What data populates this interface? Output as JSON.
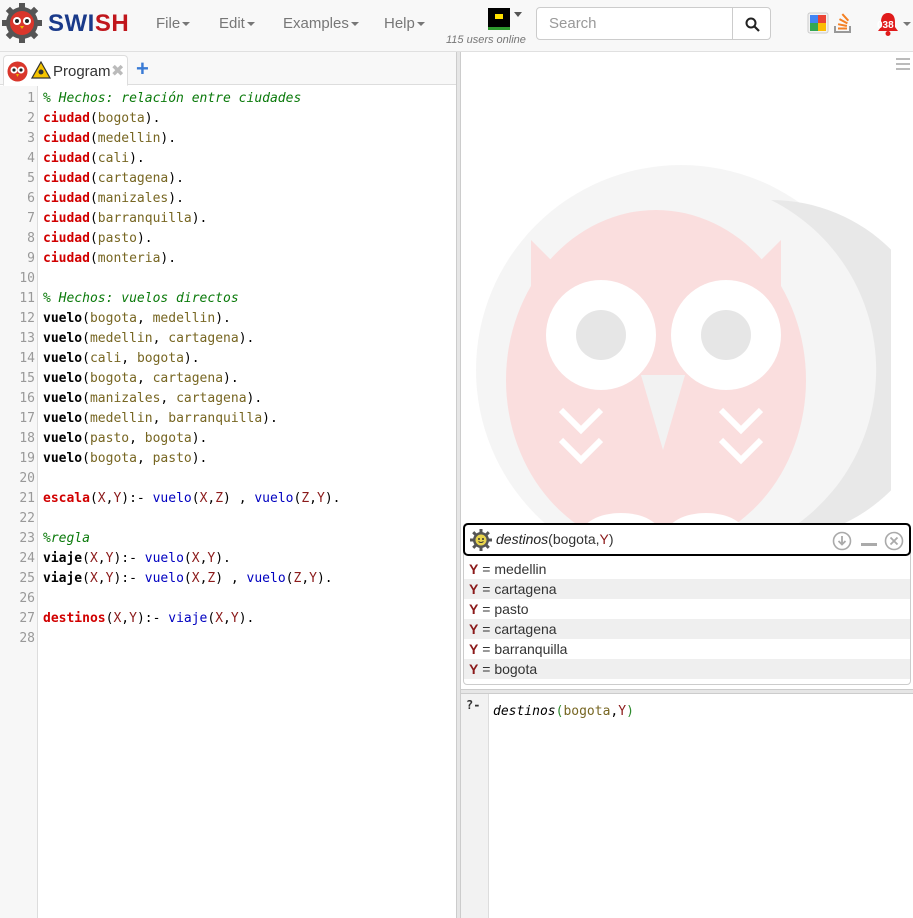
{
  "navbar": {
    "brand_sw": "SWI",
    "brand_sh": "SH",
    "menus": [
      "File",
      "Edit",
      "Examples",
      "Help"
    ],
    "users_online": "115 users online",
    "search_placeholder": "Search",
    "notification_count": "038"
  },
  "editor": {
    "tab_label": "Program",
    "lines": [
      [
        [
          "com",
          "% Hechos: relación entre ciudades"
        ]
      ],
      [
        [
          "red",
          "ciudad"
        ],
        [
          "p",
          "("
        ],
        [
          "atom",
          "bogota"
        ],
        [
          "p",
          ")."
        ]
      ],
      [
        [
          "red",
          "ciudad"
        ],
        [
          "p",
          "("
        ],
        [
          "atom",
          "medellin"
        ],
        [
          "p",
          ")."
        ]
      ],
      [
        [
          "red",
          "ciudad"
        ],
        [
          "p",
          "("
        ],
        [
          "atom",
          "cali"
        ],
        [
          "p",
          ")."
        ]
      ],
      [
        [
          "red",
          "ciudad"
        ],
        [
          "p",
          "("
        ],
        [
          "atom",
          "cartagena"
        ],
        [
          "p",
          ")."
        ]
      ],
      [
        [
          "red",
          "ciudad"
        ],
        [
          "p",
          "("
        ],
        [
          "atom",
          "manizales"
        ],
        [
          "p",
          ")."
        ]
      ],
      [
        [
          "red",
          "ciudad"
        ],
        [
          "p",
          "("
        ],
        [
          "atom",
          "barranquilla"
        ],
        [
          "p",
          ")."
        ]
      ],
      [
        [
          "red",
          "ciudad"
        ],
        [
          "p",
          "("
        ],
        [
          "atom",
          "pasto"
        ],
        [
          "p",
          ")."
        ]
      ],
      [
        [
          "red",
          "ciudad"
        ],
        [
          "p",
          "("
        ],
        [
          "atom",
          "monteria"
        ],
        [
          "p",
          ")."
        ]
      ],
      [],
      [
        [
          "com",
          "% Hechos: vuelos directos"
        ]
      ],
      [
        [
          "blk",
          "vuelo"
        ],
        [
          "p",
          "("
        ],
        [
          "atom",
          "bogota"
        ],
        [
          "p",
          ", "
        ],
        [
          "atom",
          "medellin"
        ],
        [
          "p",
          ")."
        ]
      ],
      [
        [
          "blk",
          "vuelo"
        ],
        [
          "p",
          "("
        ],
        [
          "atom",
          "medellin"
        ],
        [
          "p",
          ", "
        ],
        [
          "atom",
          "cartagena"
        ],
        [
          "p",
          ")."
        ]
      ],
      [
        [
          "blk",
          "vuelo"
        ],
        [
          "p",
          "("
        ],
        [
          "atom",
          "cali"
        ],
        [
          "p",
          ", "
        ],
        [
          "atom",
          "bogota"
        ],
        [
          "p",
          ")."
        ]
      ],
      [
        [
          "blk",
          "vuelo"
        ],
        [
          "p",
          "("
        ],
        [
          "atom",
          "bogota"
        ],
        [
          "p",
          ", "
        ],
        [
          "atom",
          "cartagena"
        ],
        [
          "p",
          ")."
        ]
      ],
      [
        [
          "blk",
          "vuelo"
        ],
        [
          "p",
          "("
        ],
        [
          "atom",
          "manizales"
        ],
        [
          "p",
          ", "
        ],
        [
          "atom",
          "cartagena"
        ],
        [
          "p",
          ")."
        ]
      ],
      [
        [
          "blk",
          "vuelo"
        ],
        [
          "p",
          "("
        ],
        [
          "atom",
          "medellin"
        ],
        [
          "p",
          ", "
        ],
        [
          "atom",
          "barranquilla"
        ],
        [
          "p",
          ")."
        ]
      ],
      [
        [
          "blk",
          "vuelo"
        ],
        [
          "p",
          "("
        ],
        [
          "atom",
          "pasto"
        ],
        [
          "p",
          ", "
        ],
        [
          "atom",
          "bogota"
        ],
        [
          "p",
          ")."
        ]
      ],
      [
        [
          "blk",
          "vuelo"
        ],
        [
          "p",
          "("
        ],
        [
          "atom",
          "bogota"
        ],
        [
          "p",
          ", "
        ],
        [
          "atom",
          "pasto"
        ],
        [
          "p",
          ")."
        ]
      ],
      [],
      [
        [
          "red",
          "escala"
        ],
        [
          "p",
          "("
        ],
        [
          "var",
          "X"
        ],
        [
          "p",
          ","
        ],
        [
          "var",
          "Y"
        ],
        [
          "p",
          "):- "
        ],
        [
          "call",
          "vuelo"
        ],
        [
          "p",
          "("
        ],
        [
          "var",
          "X"
        ],
        [
          "p",
          ","
        ],
        [
          "var",
          "Z"
        ],
        [
          "p",
          ") , "
        ],
        [
          "call",
          "vuelo"
        ],
        [
          "p",
          "("
        ],
        [
          "var",
          "Z"
        ],
        [
          "p",
          ","
        ],
        [
          "var",
          "Y"
        ],
        [
          "p",
          ")."
        ]
      ],
      [],
      [
        [
          "com",
          "%regla"
        ]
      ],
      [
        [
          "blk",
          "viaje"
        ],
        [
          "p",
          "("
        ],
        [
          "var",
          "X"
        ],
        [
          "p",
          ","
        ],
        [
          "var",
          "Y"
        ],
        [
          "p",
          "):- "
        ],
        [
          "call",
          "vuelo"
        ],
        [
          "p",
          "("
        ],
        [
          "var",
          "X"
        ],
        [
          "p",
          ","
        ],
        [
          "var",
          "Y"
        ],
        [
          "p",
          ")."
        ]
      ],
      [
        [
          "blk",
          "viaje"
        ],
        [
          "p",
          "("
        ],
        [
          "var",
          "X"
        ],
        [
          "p",
          ","
        ],
        [
          "var",
          "Y"
        ],
        [
          "p",
          "):- "
        ],
        [
          "call",
          "vuelo"
        ],
        [
          "p",
          "("
        ],
        [
          "var",
          "X"
        ],
        [
          "p",
          ","
        ],
        [
          "var",
          "Z"
        ],
        [
          "p",
          ") , "
        ],
        [
          "call",
          "vuelo"
        ],
        [
          "p",
          "("
        ],
        [
          "var",
          "Z"
        ],
        [
          "p",
          ","
        ],
        [
          "var",
          "Y"
        ],
        [
          "p",
          ")."
        ]
      ],
      [],
      [
        [
          "red",
          "destinos"
        ],
        [
          "p",
          "("
        ],
        [
          "var",
          "X"
        ],
        [
          "p",
          ","
        ],
        [
          "var",
          "Y"
        ],
        [
          "p",
          "):- "
        ],
        [
          "call",
          "viaje"
        ],
        [
          "p",
          "("
        ],
        [
          "var",
          "X"
        ],
        [
          "p",
          ","
        ],
        [
          "var",
          "Y"
        ],
        [
          "p",
          ")."
        ]
      ],
      []
    ]
  },
  "query_result": {
    "title_fn": "destinos",
    "title_open": "(",
    "title_atom": "bogota",
    "title_comma": ",",
    "title_var": "Y",
    "title_close": ")",
    "answers": [
      {
        "var": "Y",
        "eq": " = ",
        "value": "medellin"
      },
      {
        "var": "Y",
        "eq": " = ",
        "value": "cartagena"
      },
      {
        "var": "Y",
        "eq": " = ",
        "value": "pasto"
      },
      {
        "var": "Y",
        "eq": " = ",
        "value": "cartagena"
      },
      {
        "var": "Y",
        "eq": " = ",
        "value": "barranquilla"
      },
      {
        "var": "Y",
        "eq": " = ",
        "value": "bogota"
      }
    ]
  },
  "query_editor": {
    "prompt": "?-",
    "fn": "destinos",
    "open": "(",
    "atom": "bogota",
    "comma": ",",
    "var": "Y",
    "close": ")"
  },
  "colors": {
    "brand_blue": "#1a3a8a",
    "brand_red": "#c0161c",
    "variable": "#8b1a1a",
    "comment": "#0b7a0b"
  }
}
